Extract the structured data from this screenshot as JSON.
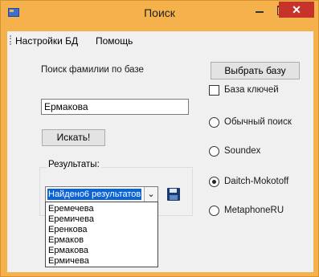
{
  "window": {
    "title": "Поиск",
    "close_glyph": "✕"
  },
  "menu": {
    "items": [
      {
        "label": "Настройки БД"
      },
      {
        "label": "Помощь"
      }
    ]
  },
  "search": {
    "label": "Поиск фамилии по базе",
    "value": "Ермакова",
    "button_label": "Искать!"
  },
  "db": {
    "button_label": "Выбрать базу",
    "key_base_label": "База ключей",
    "key_base_checked": false
  },
  "results": {
    "group_label": "Результаты:",
    "selected_value": "Найдено6 результатов",
    "arrow_glyph": "⌄",
    "items": [
      "Еремечева",
      "Еремичева",
      "Еренкова",
      "Ермаков",
      "Ермакова",
      "Ермичева"
    ]
  },
  "algorithms": {
    "selected": "Daitch-Mokotoff",
    "options": [
      {
        "label": "Обычный поиск",
        "checked": false
      },
      {
        "label": "Soundex",
        "checked": false
      },
      {
        "label": "Daitch-Mokotoff",
        "checked": true
      },
      {
        "label": "MetaphoneRU",
        "checked": false
      }
    ]
  },
  "colors": {
    "titlebar": "#f5b24c",
    "close_button": "#c7332b",
    "selection": "#0a64d8"
  },
  "icons": {
    "app": "app-icon",
    "save": "floppy-disk-icon"
  }
}
